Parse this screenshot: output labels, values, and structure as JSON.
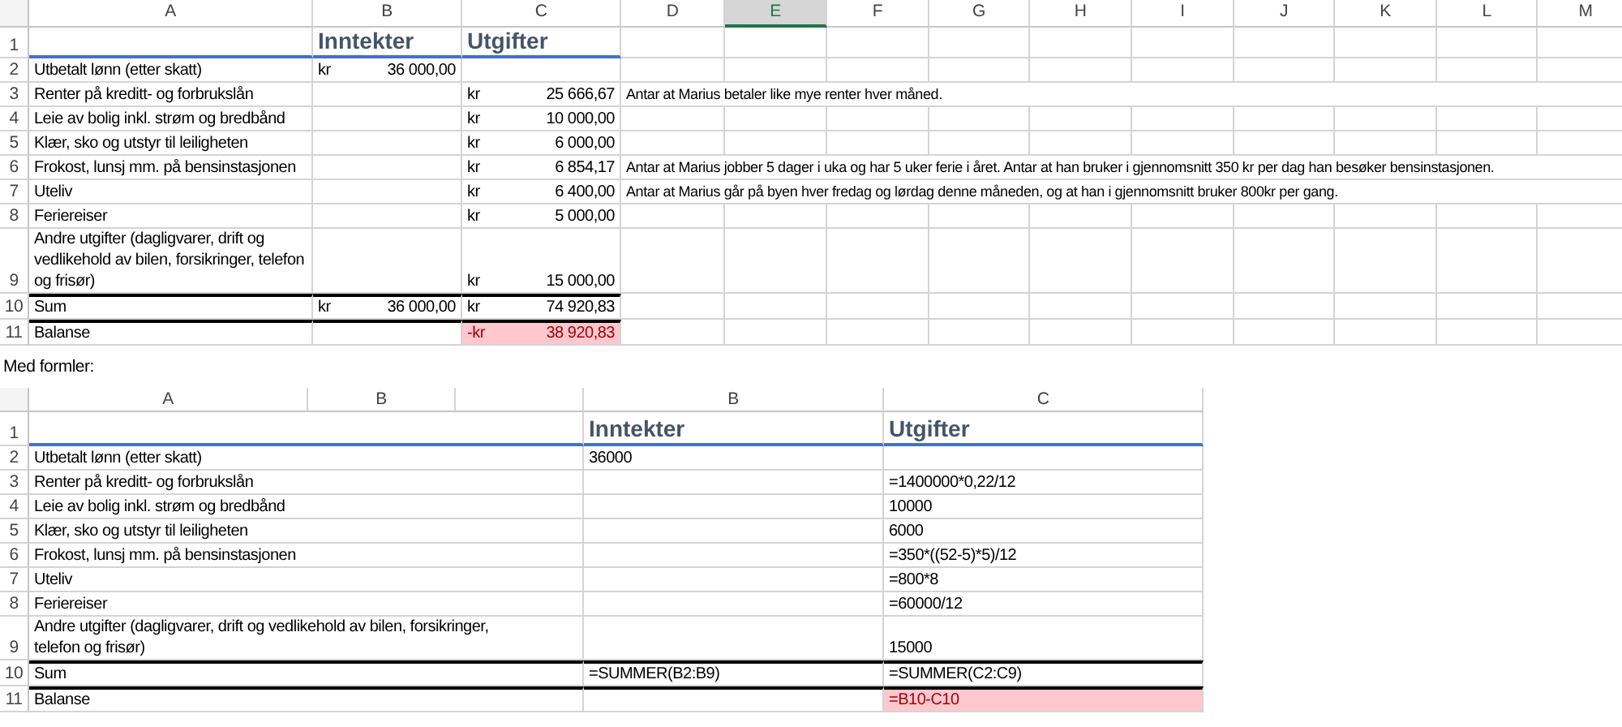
{
  "top_sheet": {
    "columns": [
      {
        "label": "A",
        "selected": false
      },
      {
        "label": "B",
        "selected": false
      },
      {
        "label": "C",
        "selected": false
      },
      {
        "label": "D",
        "selected": false
      },
      {
        "label": "E",
        "selected": true
      },
      {
        "label": "F",
        "selected": false
      },
      {
        "label": "G",
        "selected": false
      },
      {
        "label": "H",
        "selected": false
      },
      {
        "label": "I",
        "selected": false
      },
      {
        "label": "J",
        "selected": false
      },
      {
        "label": "K",
        "selected": false
      },
      {
        "label": "L",
        "selected": false
      },
      {
        "label": "M",
        "selected": false
      }
    ],
    "rows": [
      {
        "number": "1",
        "kind": "header",
        "b": "Inntekter",
        "c": "Utgifter"
      },
      {
        "number": "2",
        "kind": "item",
        "label": "Utbetalt lønn (etter skatt)",
        "b_unit": "kr",
        "b_value": "36 000,00"
      },
      {
        "number": "3",
        "kind": "item",
        "label": "Renter på kreditt- og forbrukslån",
        "c_unit": "kr",
        "c_value": "25 666,67",
        "note": "Antar at Marius betaler like mye renter hver måned."
      },
      {
        "number": "4",
        "kind": "item",
        "label": "Leie av bolig inkl. strøm og bredbånd",
        "c_unit": "kr",
        "c_value": "10 000,00"
      },
      {
        "number": "5",
        "kind": "item",
        "label": "Klær, sko og utstyr til leiligheten",
        "c_unit": "kr",
        "c_value": "6 000,00"
      },
      {
        "number": "6",
        "kind": "item",
        "label": "Frokost, lunsj mm. på bensinstasjonen",
        "c_unit": "kr",
        "c_value": "6 854,17",
        "note": "Antar at Marius jobber 5 dager i uka og har 5 uker ferie i året. Antar at han bruker i gjennomsnitt 350 kr per dag han besøker bensinstasjonen."
      },
      {
        "number": "7",
        "kind": "item",
        "label": "Uteliv",
        "c_unit": "kr",
        "c_value": "6 400,00",
        "note": "Antar at Marius går på byen hver fredag og lørdag denne måneden, og at han i gjennomsnitt bruker 800kr per gang."
      },
      {
        "number": "8",
        "kind": "item",
        "label": "Feriereiser",
        "c_unit": "kr",
        "c_value": "5 000,00"
      },
      {
        "number": "9",
        "kind": "item",
        "label": "Andre utgifter (dagligvarer, drift og vedlikehold av bilen, forsikringer, telefon og frisør)",
        "c_unit": "kr",
        "c_value": "15 000,00"
      },
      {
        "number": "10",
        "kind": "sum",
        "label": "Sum",
        "b_unit": "kr",
        "b_value": "36 000,00",
        "c_unit": "kr",
        "c_value": "74 920,83"
      },
      {
        "number": "11",
        "kind": "balance",
        "label": "Balanse",
        "c_unit": "-kr",
        "c_value": "38 920,83"
      }
    ]
  },
  "caption": "Med formler:",
  "formula_sheet": {
    "columns": [
      "A",
      "B",
      "B",
      "C"
    ],
    "rows": [
      {
        "number": "1",
        "kind": "header",
        "b": "Inntekter",
        "c": "Utgifter"
      },
      {
        "number": "2",
        "kind": "item",
        "label": "Utbetalt lønn (etter skatt)",
        "b": "36000"
      },
      {
        "number": "3",
        "kind": "item",
        "label": "Renter på kreditt- og forbrukslån",
        "c": "=1400000*0,22/12"
      },
      {
        "number": "4",
        "kind": "item",
        "label": "Leie av bolig inkl. strøm og bredbånd",
        "c": "10000"
      },
      {
        "number": "5",
        "kind": "item",
        "label": "Klær, sko og utstyr til leiligheten",
        "c": "6000"
      },
      {
        "number": "6",
        "kind": "item",
        "label": "Frokost, lunsj mm. på bensinstasjonen",
        "c": "=350*((52-5)*5)/12"
      },
      {
        "number": "7",
        "kind": "item",
        "label": "Uteliv",
        "c": "=800*8"
      },
      {
        "number": "8",
        "kind": "item",
        "label": "Feriereiser",
        "c": "=60000/12"
      },
      {
        "number": "9",
        "kind": "item",
        "label": "Andre utgifter (dagligvarer, drift og vedlikehold av bilen, forsikringer, telefon og frisør)",
        "c": "15000"
      },
      {
        "number": "10",
        "kind": "sum",
        "label": "Sum",
        "b": "=SUMMER(B2:B9)",
        "c": "=SUMMER(C2:C9)"
      },
      {
        "number": "11",
        "kind": "balance",
        "label": "Balanse",
        "c": "=B10-C10"
      }
    ]
  }
}
